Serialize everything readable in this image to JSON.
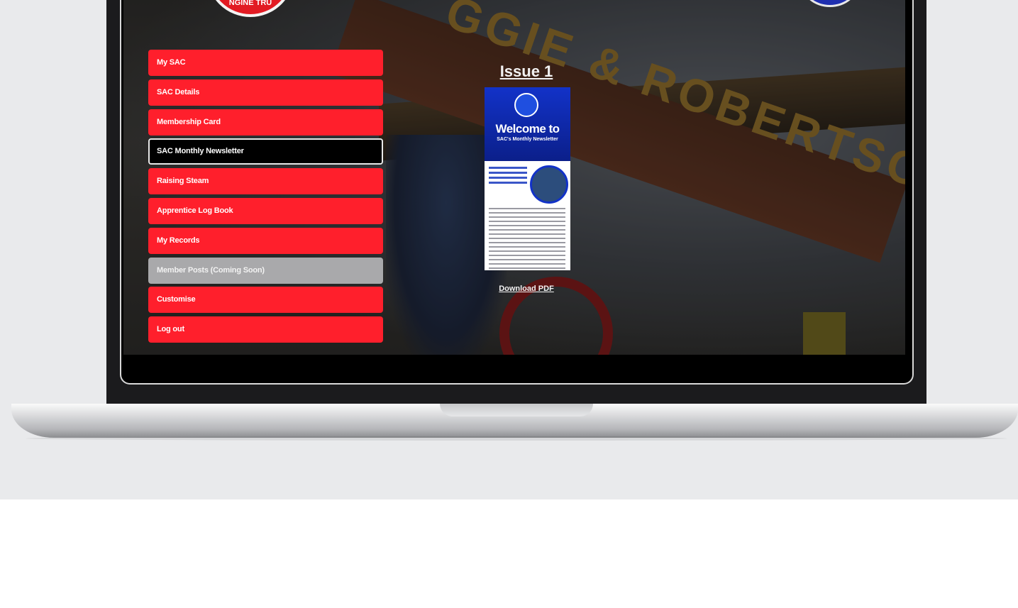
{
  "menu": {
    "items": [
      {
        "label": "My SAC",
        "state": "normal"
      },
      {
        "label": "SAC Details",
        "state": "normal"
      },
      {
        "label": "Membership Card",
        "state": "normal"
      },
      {
        "label": "SAC Monthly Newsletter",
        "state": "active"
      },
      {
        "label": "Raising Steam",
        "state": "normal"
      },
      {
        "label": "Apprentice Log Book",
        "state": "normal"
      },
      {
        "label": "My Records",
        "state": "normal"
      },
      {
        "label": "Member Posts (Coming Soon)",
        "state": "disabled"
      },
      {
        "label": "Customise",
        "state": "normal"
      },
      {
        "label": "Log out",
        "state": "normal"
      }
    ]
  },
  "header": {
    "left_logo_text": "NGINE TRU"
  },
  "background": {
    "banner_text": "GGIE & ROBERTSON"
  },
  "newsletter": {
    "issue_title": "Issue 1",
    "thumbnail_title": "Welcome to",
    "thumbnail_subtitle": "SAC's Monthly Newsletter",
    "download_label": "Download PDF"
  },
  "colors": {
    "menu_red": "#ff1f2c",
    "menu_active": "#000000",
    "menu_disabled": "#a9a9ab",
    "newsletter_blue": "#1232c8"
  }
}
